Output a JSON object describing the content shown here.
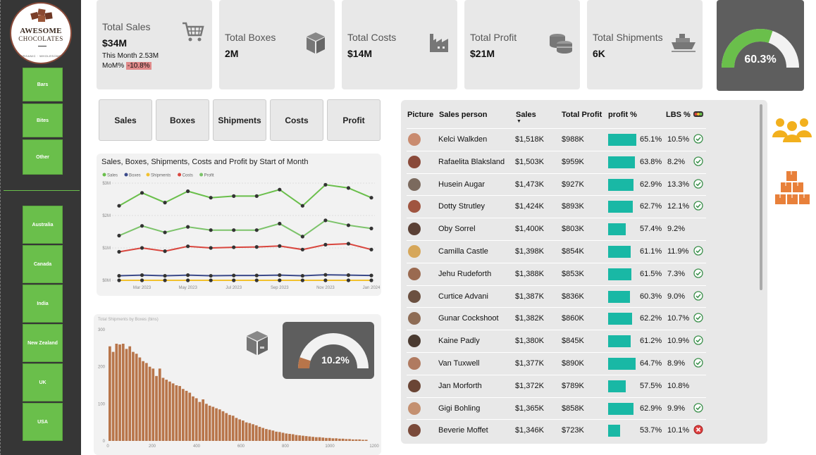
{
  "logo": {
    "line1": "AWESOME",
    "line2": "CHOCOLATES",
    "line3": "ORGANIC · WHOLESOME"
  },
  "sidebar": {
    "products": [
      {
        "label": "Bars"
      },
      {
        "label": "Bites"
      },
      {
        "label": "Other"
      }
    ],
    "countries": [
      {
        "label": "Australia"
      },
      {
        "label": "Canada"
      },
      {
        "label": "India"
      },
      {
        "label": "New Zealand"
      },
      {
        "label": "UK"
      },
      {
        "label": "USA"
      }
    ]
  },
  "kpis": {
    "sales": {
      "label": "Total Sales",
      "value": "$34M",
      "this_month": "This Month 2.53M",
      "mom_label": "MoM%",
      "mom_value": "-10.8%"
    },
    "boxes": {
      "label": "Total Boxes",
      "value": "2M"
    },
    "costs": {
      "label": "Total Costs",
      "value": "$14M"
    },
    "profit": {
      "label": "Total Profit",
      "value": "$21M"
    },
    "shipments": {
      "label": "Total Shipments",
      "value": "6K"
    },
    "gauge": {
      "value": "60.3%",
      "fraction": 0.603
    }
  },
  "tabs": [
    {
      "label": "Sales"
    },
    {
      "label": "Boxes"
    },
    {
      "label": "Shipments"
    },
    {
      "label": "Costs"
    },
    {
      "label": "Profit"
    }
  ],
  "colors": {
    "sales": "#6abf4b",
    "boxes": "#3b4a8a",
    "shipments": "#f2c12e",
    "costs": "#d9463e",
    "profit": "#7cc36a",
    "bar": "#b8754a",
    "teal": "#19b8a5",
    "sidebar_btn": "#6abf4b"
  },
  "chart_data": [
    {
      "type": "line",
      "title": "Sales, Boxes, Shipments, Costs and Profit by Start of Month",
      "x": [
        "Feb 2023",
        "Mar 2023",
        "Apr 2023",
        "May 2023",
        "Jun 2023",
        "Jul 2023",
        "Aug 2023",
        "Sep 2023",
        "Oct 2023",
        "Nov 2023",
        "Dec 2023",
        "Jan 2024",
        "Feb 2024"
      ],
      "xticks": [
        "Mar 2023",
        "May 2023",
        "Jul 2023",
        "Sep 2023",
        "Nov 2023",
        "Jan 2024"
      ],
      "yticks": [
        "$0M",
        "$1M",
        "$2M",
        "$3M"
      ],
      "ylim": [
        0,
        3.0
      ],
      "series": [
        {
          "name": "Sales",
          "color": "#6abf4b",
          "values": [
            2.3,
            2.7,
            2.4,
            2.75,
            2.55,
            2.6,
            2.6,
            2.8,
            2.3,
            2.95,
            2.85,
            2.55
          ]
        },
        {
          "name": "Boxes",
          "color": "#3b4a8a",
          "values": [
            0.14,
            0.16,
            0.14,
            0.16,
            0.14,
            0.15,
            0.15,
            0.16,
            0.14,
            0.17,
            0.16,
            0.15
          ]
        },
        {
          "name": "Shipments",
          "color": "#f2c12e",
          "values": [
            0.0,
            0.0,
            0.0,
            0.0,
            0.0,
            0.0,
            0.0,
            0.0,
            0.0,
            0.0,
            0.0,
            0.0
          ]
        },
        {
          "name": "Costs",
          "color": "#d9463e",
          "values": [
            0.88,
            1.0,
            0.9,
            1.05,
            1.0,
            1.02,
            1.03,
            1.06,
            0.95,
            1.1,
            1.13,
            0.95
          ]
        },
        {
          "name": "Profit",
          "color": "#7cc36a",
          "values": [
            1.38,
            1.68,
            1.48,
            1.65,
            1.55,
            1.55,
            1.55,
            1.75,
            1.35,
            1.85,
            1.7,
            1.6
          ]
        }
      ]
    },
    {
      "type": "bar",
      "title": "Total Shipments by Boxes (bins)",
      "xticks": [
        "0",
        "200",
        "400",
        "600",
        "800",
        "1000",
        "1200"
      ],
      "yticks": [
        "0",
        "100",
        "200",
        "300"
      ],
      "xlim": [
        0,
        1200
      ],
      "ylim": [
        0,
        300
      ],
      "bin_width": 15,
      "values": [
        255,
        240,
        262,
        260,
        262,
        248,
        255,
        240,
        235,
        225,
        215,
        210,
        200,
        195,
        175,
        195,
        170,
        165,
        160,
        155,
        150,
        148,
        140,
        135,
        130,
        120,
        115,
        105,
        112,
        100,
        95,
        92,
        88,
        85,
        80,
        75,
        70,
        68,
        62,
        58,
        55,
        50,
        48,
        45,
        42,
        38,
        35,
        32,
        30,
        28,
        25,
        24,
        22,
        20,
        19,
        18,
        16,
        15,
        14,
        13,
        12,
        11,
        10,
        10,
        9,
        8,
        8,
        7,
        7,
        6,
        6,
        5,
        5,
        4,
        4,
        4,
        3,
        3
      ]
    }
  ],
  "shipments_gauge": {
    "value": "10.2%",
    "fraction": 0.102
  },
  "table": {
    "headers": {
      "picture": "Picture",
      "person": "Sales person",
      "sales": "Sales",
      "profit": "Total Profit",
      "profit_pct": "profit %",
      "lbs": "LBS %"
    },
    "rows": [
      {
        "name": "Kelci Walkden",
        "sales": "$1,518K",
        "profit": "$988K",
        "pct": "65.1%",
        "pct_v": 65.1,
        "lbs": "10.5%",
        "status": "ok"
      },
      {
        "name": "Rafaelita Blaksland",
        "sales": "$1,503K",
        "profit": "$959K",
        "pct": "63.8%",
        "pct_v": 63.8,
        "lbs": "8.2%",
        "status": "ok"
      },
      {
        "name": "Husein Augar",
        "sales": "$1,473K",
        "profit": "$927K",
        "pct": "62.9%",
        "pct_v": 62.9,
        "lbs": "13.3%",
        "status": "ok"
      },
      {
        "name": "Dotty Strutley",
        "sales": "$1,424K",
        "profit": "$893K",
        "pct": "62.7%",
        "pct_v": 62.7,
        "lbs": "12.1%",
        "status": "ok"
      },
      {
        "name": "Oby Sorrel",
        "sales": "$1,400K",
        "profit": "$803K",
        "pct": "57.4%",
        "pct_v": 57.4,
        "lbs": "9.2%",
        "status": "none"
      },
      {
        "name": "Camilla Castle",
        "sales": "$1,398K",
        "profit": "$854K",
        "pct": "61.1%",
        "pct_v": 61.1,
        "lbs": "11.9%",
        "status": "ok"
      },
      {
        "name": "Jehu Rudeforth",
        "sales": "$1,388K",
        "profit": "$853K",
        "pct": "61.5%",
        "pct_v": 61.5,
        "lbs": "7.3%",
        "status": "ok"
      },
      {
        "name": "Curtice Advani",
        "sales": "$1,387K",
        "profit": "$836K",
        "pct": "60.3%",
        "pct_v": 60.3,
        "lbs": "9.0%",
        "status": "ok"
      },
      {
        "name": "Gunar Cockshoot",
        "sales": "$1,382K",
        "profit": "$860K",
        "pct": "62.2%",
        "pct_v": 62.2,
        "lbs": "10.7%",
        "status": "ok"
      },
      {
        "name": "Kaine Padly",
        "sales": "$1,380K",
        "profit": "$845K",
        "pct": "61.2%",
        "pct_v": 61.2,
        "lbs": "10.9%",
        "status": "ok"
      },
      {
        "name": "Van Tuxwell",
        "sales": "$1,377K",
        "profit": "$890K",
        "pct": "64.7%",
        "pct_v": 64.7,
        "lbs": "8.9%",
        "status": "ok"
      },
      {
        "name": "Jan Morforth",
        "sales": "$1,372K",
        "profit": "$789K",
        "pct": "57.5%",
        "pct_v": 57.5,
        "lbs": "10.8%",
        "status": "none"
      },
      {
        "name": "Gigi Bohling",
        "sales": "$1,365K",
        "profit": "$858K",
        "pct": "62.9%",
        "pct_v": 62.9,
        "lbs": "9.9%",
        "status": "ok"
      },
      {
        "name": "Beverie Moffet",
        "sales": "$1,346K",
        "profit": "$723K",
        "pct": "53.7%",
        "pct_v": 53.7,
        "lbs": "10.1%",
        "status": "bad"
      }
    ]
  }
}
